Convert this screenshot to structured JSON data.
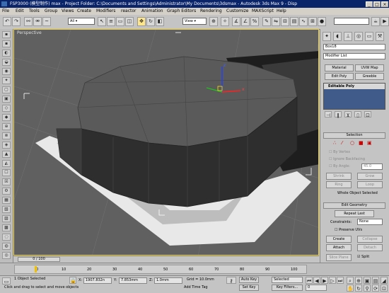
{
  "window": {
    "title": "FSP3000 (模型制作) max - Project Folder: C:\\Documents and Settings\\Administrator\\My Documents\\3dsmax - Autodesk 3ds Max 9 - Disp"
  },
  "menu": [
    "File",
    "Edit",
    "Tools",
    "Group",
    "Views",
    "Create",
    "Modifiers",
    "reactor",
    "Animation",
    "Graph Editors",
    "Rendering",
    "Customize",
    "MAXScript",
    "Help"
  ],
  "toolbar": {
    "selection_filter": "All",
    "reference_coord": "View"
  },
  "viewport": {
    "label": "Perspective"
  },
  "command_panel": {
    "object_name": "Box18",
    "modifier_list": "Modifier List",
    "buttons": [
      "Material",
      "UVW Map",
      "Edit Poly",
      "Greeble"
    ],
    "stack_item": "Editable Poly",
    "selection_rollout": "Selection",
    "by_vertex": "By Vertex",
    "ignore_backfacing": "Ignore Backfacing",
    "by_angle": "By Angle:",
    "by_angle_value": "45.0",
    "shrink": "Shrink",
    "grow": "Grow",
    "ring": "Ring",
    "loop": "Loop",
    "selection_status": "Whole Object Selected",
    "edit_geometry_rollout": "Edit Geometry",
    "repeat_last": "Repeat Last",
    "constraints_label": "Constraints:",
    "constraints_value": "None",
    "preserve_uvs": "Preserve UVs",
    "create": "Create",
    "collapse": "Collapse",
    "attach": "Attach",
    "detach": "Detach",
    "slice_plane": "Slice Plane",
    "split": "Split"
  },
  "timeline": {
    "frame": "0 / 100",
    "ticks": [
      "0",
      "10",
      "20",
      "30",
      "40",
      "50",
      "60",
      "70",
      "80",
      "90",
      "100"
    ]
  },
  "status": {
    "selected": "1 Object Selected",
    "prompt": "Click and drag to select and move objects",
    "x_label": "X:",
    "x_value": "1907.832n",
    "y_label": "Y:",
    "y_value": "7.853mm",
    "z_label": "Z:",
    "z_value": "1.0mm",
    "grid": "Grid = 10.0mm",
    "add_time_tag": "Add Time Tag",
    "auto_key": "Auto Key",
    "set_key": "Set Key",
    "key_mode": "Selected",
    "key_filters": "Key Filters...",
    "frame_value": "0"
  }
}
